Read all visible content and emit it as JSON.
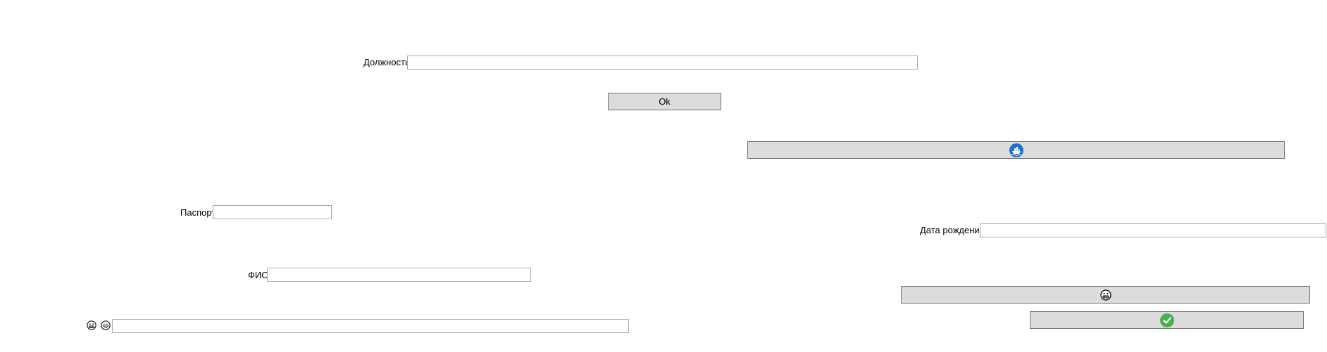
{
  "position": {
    "label": "Должность",
    "value": ""
  },
  "ok_button": {
    "label": "Ok"
  },
  "passport": {
    "label": "Паспорт",
    "value": ""
  },
  "birth_date": {
    "label": "Дата рождения",
    "value": ""
  },
  "full_name": {
    "label": "ФИО",
    "value": ""
  },
  "emoji_field": {
    "value": "",
    "icons": [
      "grimace-face-icon",
      "grinning-face-icon"
    ]
  },
  "icon_buttons": {
    "ship": {
      "icon": "ship-icon",
      "color": "#1e73c8"
    },
    "face": {
      "icon": "grimace-face-icon"
    },
    "confirm": {
      "icon": "checkmark-icon",
      "color": "#4caf50"
    }
  }
}
